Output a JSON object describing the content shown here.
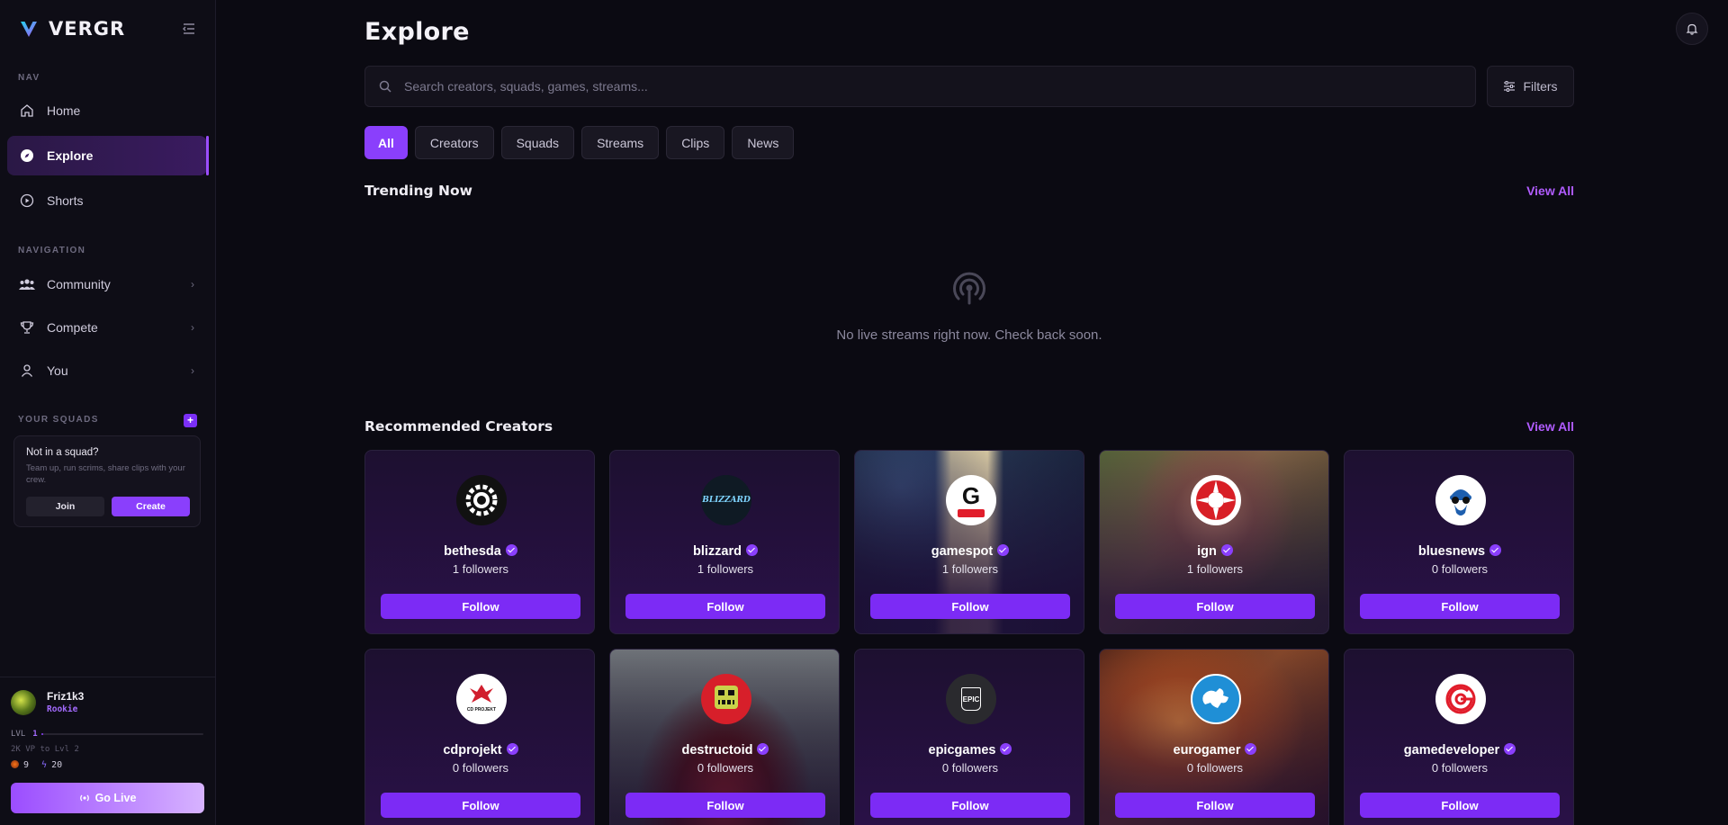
{
  "sidebar": {
    "brand": "VERGR",
    "nav_label": "NAV",
    "nav": [
      {
        "label": "Home",
        "icon": "home-icon"
      },
      {
        "label": "Explore",
        "icon": "compass-icon",
        "active": true
      },
      {
        "label": "Shorts",
        "icon": "play-circle-icon"
      }
    ],
    "navigation_label": "NAVIGATION",
    "navigation": [
      {
        "label": "Community",
        "icon": "users-icon"
      },
      {
        "label": "Compete",
        "icon": "trophy-icon"
      },
      {
        "label": "You",
        "icon": "user-icon"
      }
    ],
    "squads_label": "YOUR SQUADS",
    "squad_add": "+",
    "squad_card": {
      "title": "Not in a squad?",
      "description": "Team up, run scrims, share clips with your crew.",
      "join": "Join",
      "create": "Create"
    },
    "profile": {
      "name": "Friz1k3",
      "rank": "Rookie",
      "level_label": "LVL",
      "level": "1",
      "level_progress": 0.01,
      "vp_note": "2K VP to Lvl 2",
      "stat1": "9",
      "stat2": "20",
      "go_live": "Go Live"
    }
  },
  "main": {
    "title": "Explore",
    "search_placeholder": "Search creators, squads, games, streams...",
    "filters": "Filters",
    "tabs": [
      {
        "label": "All",
        "active": true
      },
      {
        "label": "Creators"
      },
      {
        "label": "Squads"
      },
      {
        "label": "Streams"
      },
      {
        "label": "Clips"
      },
      {
        "label": "News"
      }
    ],
    "trending": {
      "title": "Trending Now",
      "view_all": "View All",
      "empty": "No live streams right now. Check back soon."
    },
    "recommended": {
      "title": "Recommended Creators",
      "view_all": "View All",
      "follow": "Follow",
      "creators": [
        {
          "name": "bethesda",
          "followers": "1 followers",
          "logo_text": ""
        },
        {
          "name": "blizzard",
          "followers": "1 followers",
          "logo_text": "BLIZZARD"
        },
        {
          "name": "gamespot",
          "followers": "1 followers",
          "logo_text": "G"
        },
        {
          "name": "ign",
          "followers": "1 followers",
          "logo_text": ""
        },
        {
          "name": "bluesnews",
          "followers": "0 followers",
          "logo_text": ""
        },
        {
          "name": "cdprojekt",
          "followers": "0 followers",
          "logo_text": "CD PROJEKT"
        },
        {
          "name": "destructoid",
          "followers": "0 followers",
          "logo_text": ""
        },
        {
          "name": "epicgames",
          "followers": "0 followers",
          "logo_text": "EPIC"
        },
        {
          "name": "eurogamer",
          "followers": "0 followers",
          "logo_text": ""
        },
        {
          "name": "gamedeveloper",
          "followers": "0 followers",
          "logo_text": ""
        }
      ]
    }
  },
  "colors": {
    "accent": "#8a3ffc",
    "accent_text": "#b15cff",
    "background": "#0b0a12"
  }
}
